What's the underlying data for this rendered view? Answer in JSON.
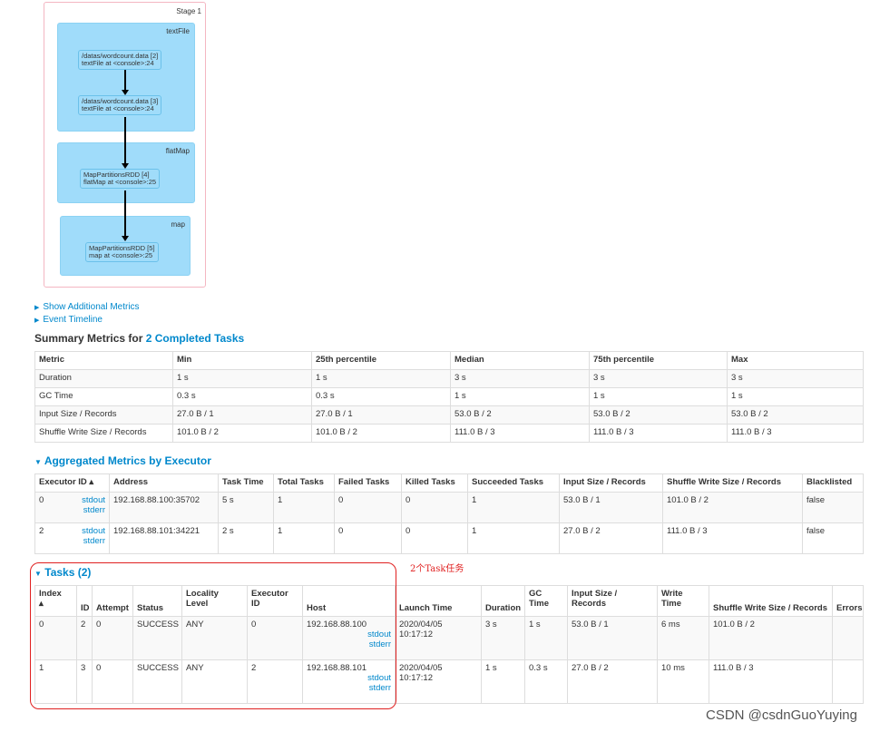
{
  "dag": {
    "stage_label": "Stage 1",
    "clusters": [
      {
        "label": "textFile",
        "nodes": [
          {
            "line1": "/datas/wordcount.data [2]",
            "line2": "textFile at <console>:24"
          },
          {
            "line1": "/datas/wordcount.data [3]",
            "line2": "textFile at <console>:24"
          }
        ]
      },
      {
        "label": "flatMap",
        "nodes": [
          {
            "line1": "MapPartitionsRDD [4]",
            "line2": "flatMap at <console>:25"
          }
        ]
      },
      {
        "label": "map",
        "nodes": [
          {
            "line1": "MapPartitionsRDD [5]",
            "line2": "map at <console>:25"
          }
        ]
      }
    ]
  },
  "links": {
    "show_additional_metrics": "Show Additional Metrics",
    "event_timeline": "Event Timeline"
  },
  "summary": {
    "title_prefix": "Summary Metrics for ",
    "title_link": "2 Completed Tasks",
    "headers": [
      "Metric",
      "Min",
      "25th percentile",
      "Median",
      "75th percentile",
      "Max"
    ],
    "rows": [
      [
        "Duration",
        "1 s",
        "1 s",
        "3 s",
        "3 s",
        "3 s"
      ],
      [
        "GC Time",
        "0.3 s",
        "0.3 s",
        "1 s",
        "1 s",
        "1 s"
      ],
      [
        "Input Size / Records",
        "27.0 B / 1",
        "27.0 B / 1",
        "53.0 B / 2",
        "53.0 B / 2",
        "53.0 B / 2"
      ],
      [
        "Shuffle Write Size / Records",
        "101.0 B / 2",
        "101.0 B / 2",
        "111.0 B / 3",
        "111.0 B / 3",
        "111.0 B / 3"
      ]
    ]
  },
  "executors": {
    "title": "Aggregated Metrics by Executor",
    "headers": [
      "Executor ID ▴",
      "Address",
      "Task Time",
      "Total Tasks",
      "Failed Tasks",
      "Killed Tasks",
      "Succeeded Tasks",
      "Input Size / Records",
      "Shuffle Write Size / Records",
      "Blacklisted"
    ],
    "rows": [
      {
        "id": "0",
        "stdout": "stdout",
        "stderr": "stderr",
        "address": "192.168.88.100:35702",
        "task_time": "5 s",
        "total": "1",
        "failed": "0",
        "killed": "0",
        "succeeded": "1",
        "input": "53.0 B / 1",
        "shuffle": "101.0 B / 2",
        "blacklisted": "false"
      },
      {
        "id": "2",
        "stdout": "stdout",
        "stderr": "stderr",
        "address": "192.168.88.101:34221",
        "task_time": "2 s",
        "total": "1",
        "failed": "0",
        "killed": "0",
        "succeeded": "1",
        "input": "27.0 B / 2",
        "shuffle": "111.0 B / 3",
        "blacklisted": "false"
      }
    ]
  },
  "tasks": {
    "title": "Tasks (2)",
    "headers": {
      "index": "Index",
      "index_sort": "▴",
      "id": "ID",
      "attempt": "Attempt",
      "status": "Status",
      "locality1": "Locality",
      "locality2": "Level",
      "executor1": "Executor",
      "executor2": "ID",
      "host": "Host",
      "launch": "Launch Time",
      "duration": "Duration",
      "gc1": "GC",
      "gc2": "Time",
      "input1": "Input Size /",
      "input2": "Records",
      "write1": "Write",
      "write2": "Time",
      "shuffle": "Shuffle Write Size / Records",
      "errors": "Errors"
    },
    "rows": [
      {
        "index": "0",
        "id": "2",
        "attempt": "0",
        "status": "SUCCESS",
        "locality": "ANY",
        "executor": "0",
        "host": "192.168.88.100",
        "stdout": "stdout",
        "stderr": "stderr",
        "launch1": "2020/04/05",
        "launch2": "10:17:12",
        "duration": "3 s",
        "gc": "1 s",
        "input": "53.0 B / 1",
        "write": "6 ms",
        "shuffle": "101.0 B / 2",
        "errors": ""
      },
      {
        "index": "1",
        "id": "3",
        "attempt": "0",
        "status": "SUCCESS",
        "locality": "ANY",
        "executor": "2",
        "host": "192.168.88.101",
        "stdout": "stdout",
        "stderr": "stderr",
        "launch1": "2020/04/05",
        "launch2": "10:17:12",
        "duration": "1 s",
        "gc": "0.3 s",
        "input": "27.0 B / 2",
        "write": "10 ms",
        "shuffle": "111.0 B / 3",
        "errors": ""
      }
    ]
  },
  "annotation": "2个Task任务",
  "watermark": "CSDN @csdnGuoYuying"
}
